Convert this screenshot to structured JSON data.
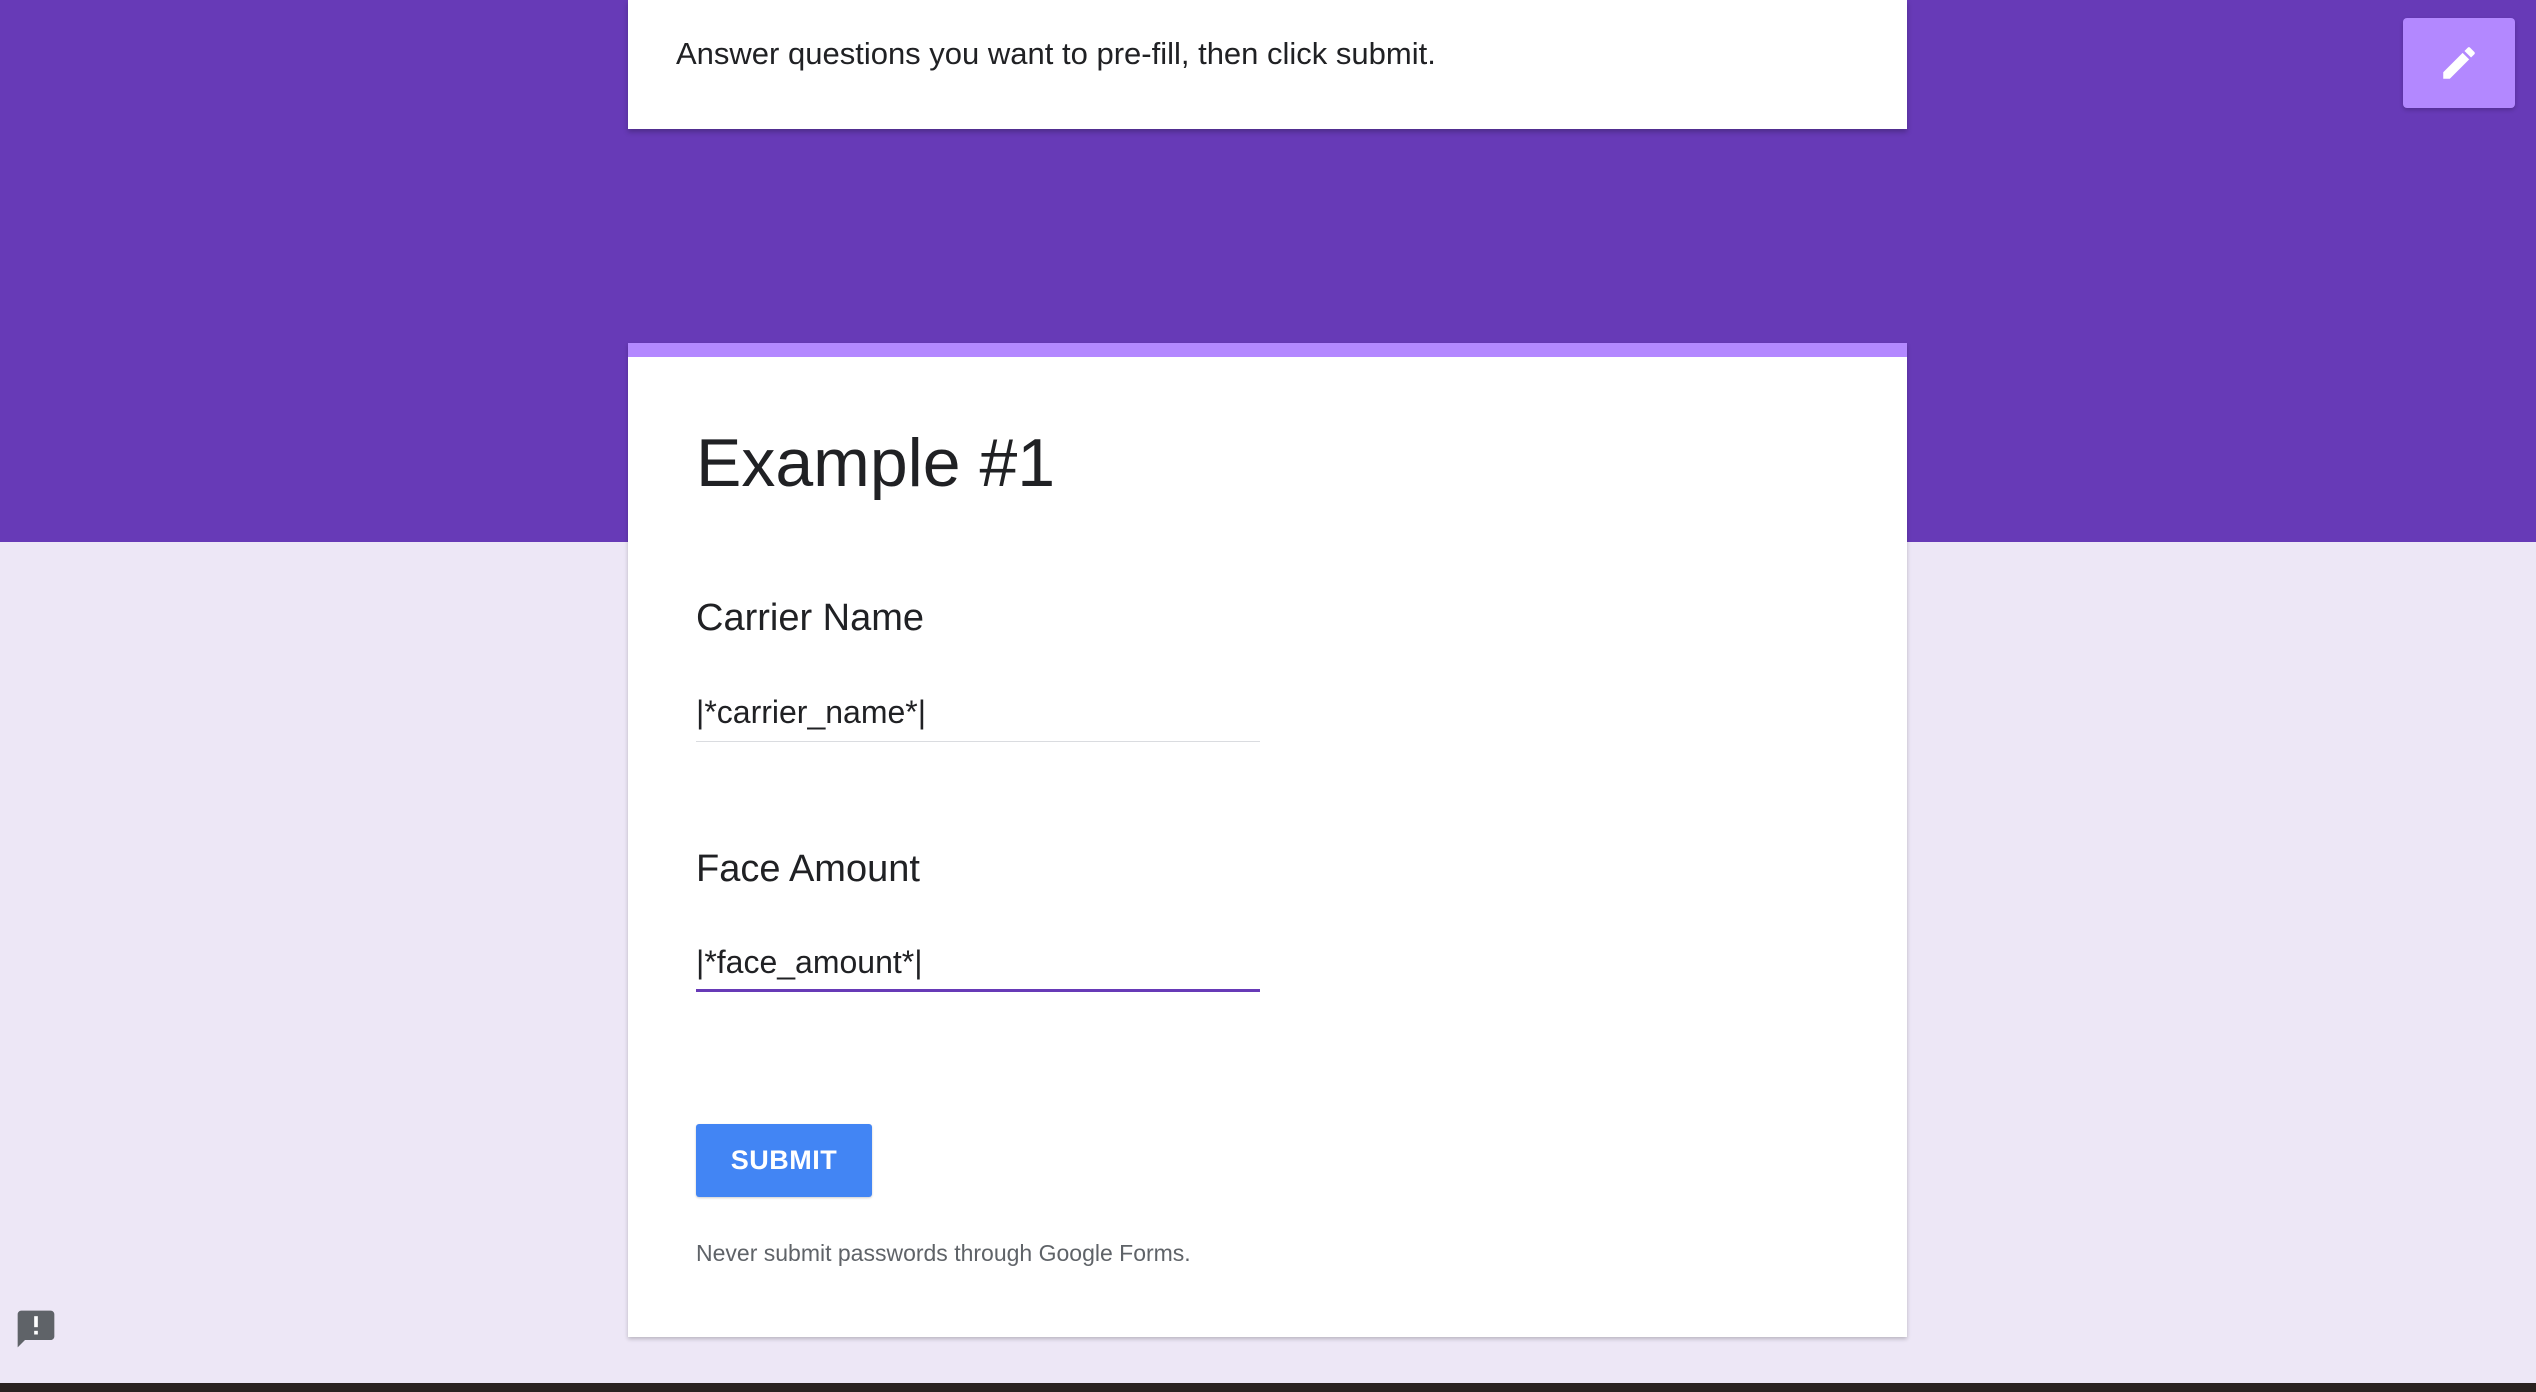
{
  "info_banner": {
    "text": "Answer questions you want to pre-fill, then click submit."
  },
  "edit_fab": {
    "icon": "pencil-icon"
  },
  "form": {
    "title": "Example #1",
    "questions": [
      {
        "label": "Carrier Name",
        "value": "|*carrier_name*|",
        "focused": false
      },
      {
        "label": "Face Amount",
        "value": "|*face_amount*|",
        "focused": true
      }
    ],
    "submit_label": "SUBMIT",
    "disclaimer": "Never submit passwords through Google Forms."
  },
  "feedback": {
    "icon": "report-problem-icon"
  },
  "colors": {
    "header_purple": "#673ab7",
    "accent_lavender": "#b388ff",
    "page_background": "#ede7f6",
    "submit_blue": "#4285f4"
  }
}
